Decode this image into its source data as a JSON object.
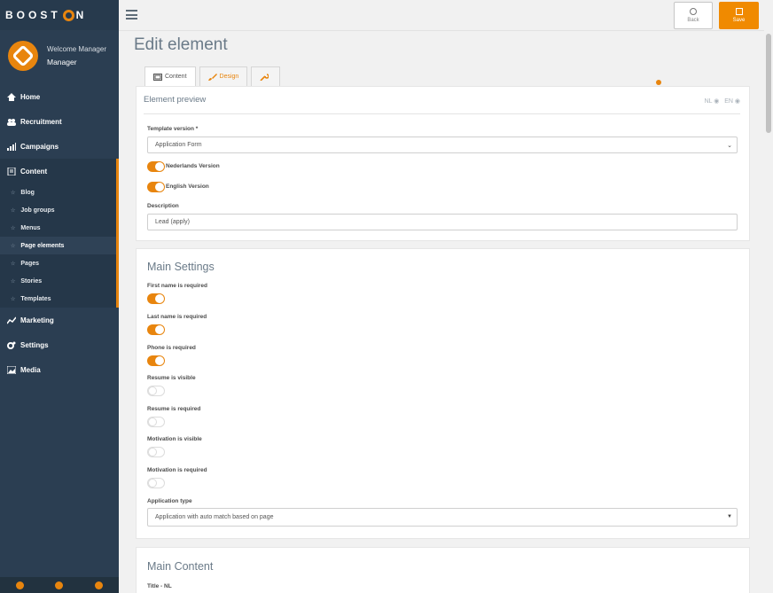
{
  "brand": {
    "logo_left": "BOOST",
    "logo_right": "N",
    "accent": "#e8850e"
  },
  "user": {
    "welcome": "Welcome Manager",
    "role": "Manager"
  },
  "nav": [
    {
      "label": "Home",
      "icon": "home-icon"
    },
    {
      "label": "Recruitment",
      "icon": "users-icon"
    },
    {
      "label": "Campaigns",
      "icon": "signal-icon"
    },
    {
      "label": "Content",
      "icon": "file-icon"
    }
  ],
  "subnav": [
    "Blog",
    "Job groups",
    "Menus",
    "Page elements",
    "Pages",
    "Stories",
    "Templates"
  ],
  "nav_bottom": [
    {
      "label": "Marketing",
      "icon": "chart-icon"
    },
    {
      "label": "Settings",
      "icon": "gears-icon"
    },
    {
      "label": "Media",
      "icon": "image-icon"
    }
  ],
  "topbar": {
    "back": "Back",
    "save": "Save"
  },
  "page": {
    "title": "Edit element"
  },
  "tabs": [
    "Content",
    "Design",
    ""
  ],
  "preview": {
    "heading": "Element preview",
    "lang_nl": "NL",
    "lang_en": "EN",
    "template_label": "Template version *",
    "template_value": "Application Form",
    "toggle_nl": "Nederlands Version",
    "toggle_en": "English Version",
    "description_label": "Description",
    "description_value": "Lead (apply)"
  },
  "main_settings": {
    "heading": "Main Settings",
    "items": [
      {
        "label": "First name is required",
        "on": true
      },
      {
        "label": "Last name is required",
        "on": true
      },
      {
        "label": "Phone is required",
        "on": true
      },
      {
        "label": "Resume is visible",
        "on": false
      },
      {
        "label": "Resume is required",
        "on": false
      },
      {
        "label": "Motivation is visible",
        "on": false
      },
      {
        "label": "Motivation is required",
        "on": false
      }
    ],
    "application_type_label": "Application type",
    "application_type_value": "Application with auto match based on page"
  },
  "main_content": {
    "heading": "Main Content",
    "title_label": "Title - NL"
  }
}
